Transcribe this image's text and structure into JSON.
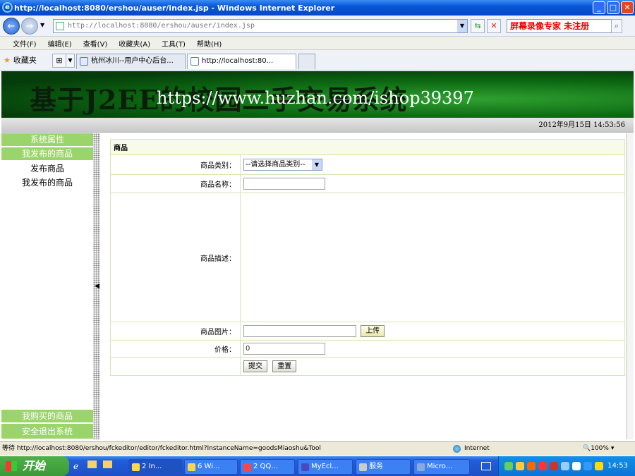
{
  "window": {
    "title": "http://localhost:8080/ershou/auser/index.jsp - Windows Internet Explorer"
  },
  "address": {
    "url": "http://localhost:8080/ershou/auser/index.jsp",
    "search_text": "屏幕录像专家 未注册"
  },
  "menu": {
    "items": [
      "文件(F)",
      "编辑(E)",
      "查看(V)",
      "收藏夹(A)",
      "工具(T)",
      "帮助(H)"
    ]
  },
  "tabs": {
    "favorites_label": "收藏夹",
    "items": [
      "杭州冰川--用户中心后台...",
      "http://localhost:80..."
    ]
  },
  "banner": {
    "title": "基于J2EE的校园二手交易系统",
    "watermark": "https://www.huzhan.com/ishop39397"
  },
  "datebar": {
    "datetime": "2012年9月15日  14:53:56"
  },
  "sidebar": {
    "sections": [
      "系统属性",
      "我发布的商品"
    ],
    "items": [
      "发布商品",
      "我发布的商品"
    ],
    "bottom_sections": [
      "我购买的商品",
      "安全退出系统"
    ]
  },
  "form": {
    "header": "商品",
    "category_label": "商品类别：",
    "category_value": "--请选择商品类别--",
    "name_label": "商品名称：",
    "description_label": "商品描述：",
    "image_label": "商品图片：",
    "upload_button": "上传",
    "price_label": "价格：",
    "price_value": "0",
    "submit_button": "提交",
    "reset_button": "重置"
  },
  "status": {
    "text": "等待 http://localhost:8080/ershou/fckeditor/editor/fckeditor.html?InstanceName=goodsMiaoshu&Tool",
    "zone": "Internet",
    "zoom": "100%"
  },
  "taskbar": {
    "start": "开始",
    "tasks": [
      "2 In...",
      "6 Wi...",
      "2 QQ...",
      "MyEcl...",
      "服务",
      "Micro..."
    ],
    "clock": "14:53"
  },
  "colors": {
    "sidebar_header": "#9bd46b",
    "banner_green": "#0d6a13",
    "titlebar": "#0a56d8"
  }
}
